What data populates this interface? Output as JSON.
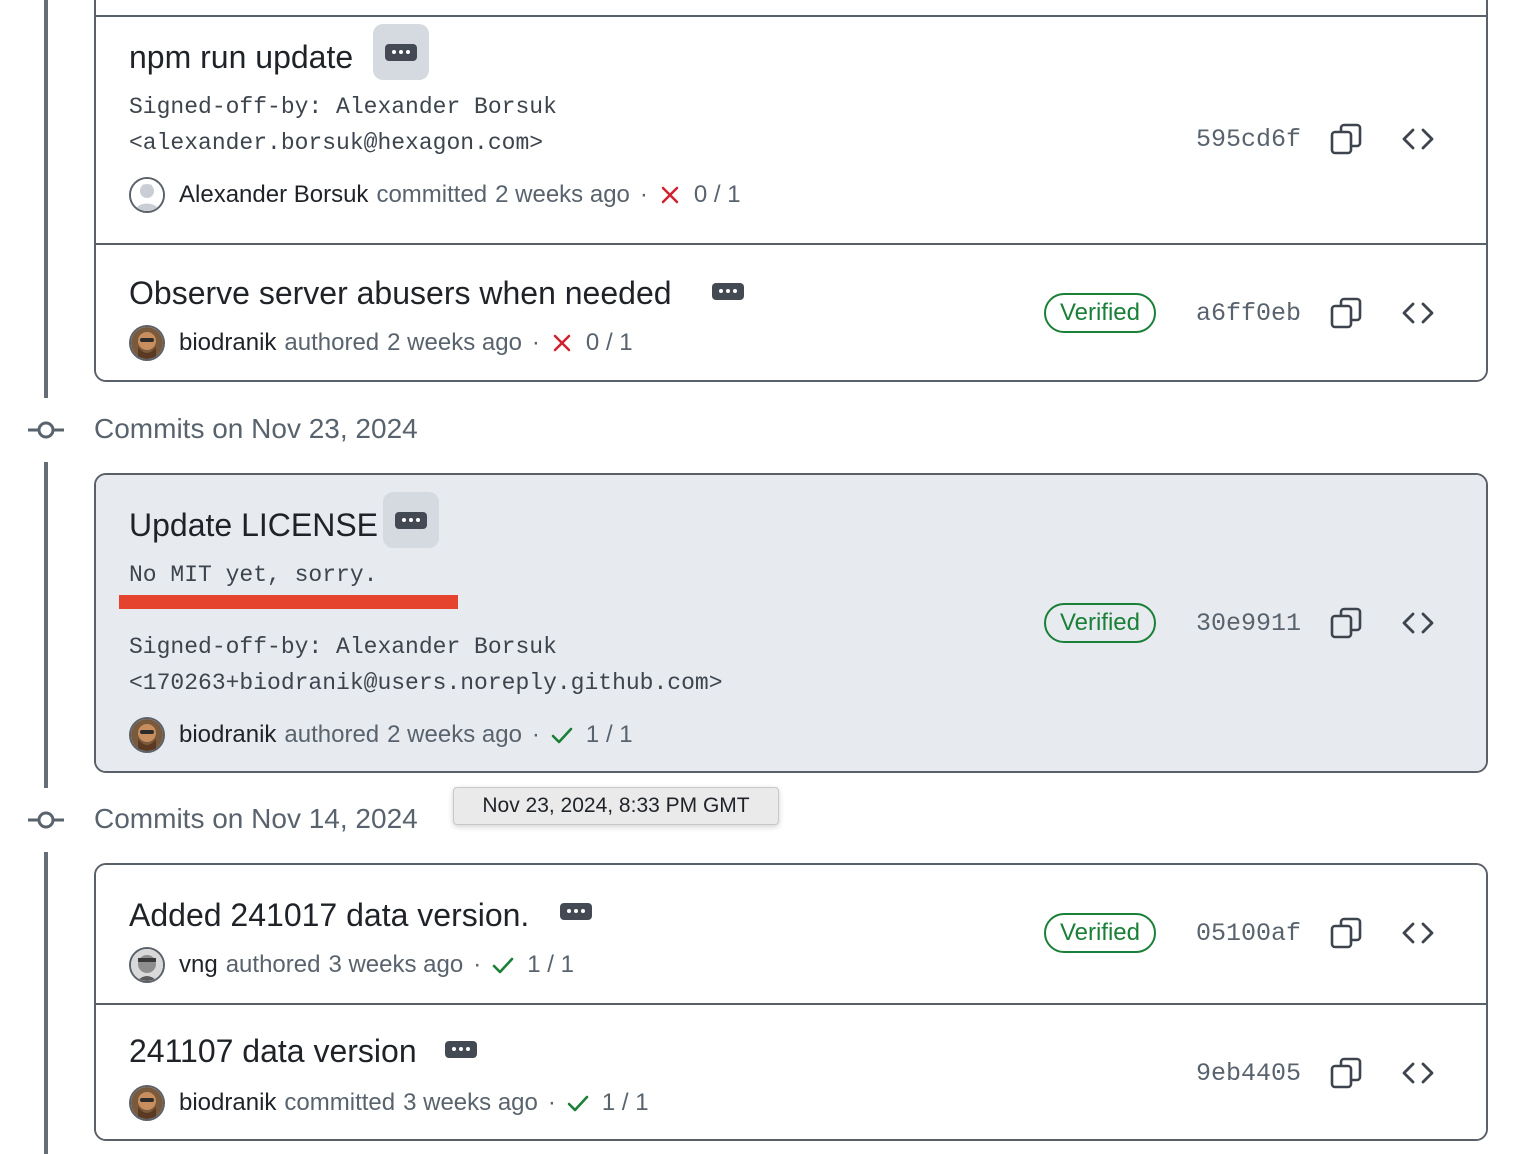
{
  "groups": [
    {
      "commits": [
        {
          "title": "npm run update",
          "body": "Signed-off-by: Alexander Borsuk\n<alexander.borsuk@hexagon.com>",
          "author": "Alexander Borsuk",
          "action": "committed",
          "time": "2 weeks ago",
          "checks_status": "failure",
          "checks": "0 / 1",
          "verified": null,
          "sha": "595cd6f",
          "avatar_icon": "github-default-avatar-icon"
        },
        {
          "title": "Observe server abusers when needed",
          "author": "biodranik",
          "action": "authored",
          "time": "2 weeks ago",
          "checks_status": "failure",
          "checks": "0 / 1",
          "verified": "Verified",
          "sha": "a6ff0eb",
          "avatar_icon": "user-avatar-icon"
        }
      ]
    },
    {
      "date_heading": "Commits on Nov 23, 2024",
      "commits": [
        {
          "title": "Update LICENSE",
          "body_line1": "No MIT yet, sorry.",
          "body_signoff": "Signed-off-by: Alexander Borsuk\n<170263+biodranik@users.noreply.github.com>",
          "author": "biodranik",
          "action": "authored",
          "time": "2 weeks ago",
          "checks_status": "success",
          "checks": "1 / 1",
          "verified": "Verified",
          "sha": "30e9911",
          "avatar_icon": "user-avatar-icon"
        }
      ]
    },
    {
      "date_heading": "Commits on Nov 14, 2024",
      "commits": [
        {
          "title": "Added 241017 data version.",
          "author": "vng",
          "action": "authored",
          "time": "3 weeks ago",
          "checks_status": "success",
          "checks": "1 / 1",
          "verified": "Verified",
          "sha": "05100af",
          "avatar_icon": "user-avatar-icon"
        },
        {
          "title": "241107 data version",
          "author": "biodranik",
          "action": "committed",
          "time": "3 weeks ago",
          "checks_status": "success",
          "checks": "1 / 1",
          "verified": null,
          "sha": "9eb4405",
          "avatar_icon": "user-avatar-icon"
        }
      ]
    }
  ],
  "tooltip": "Nov 23, 2024, 8:33 PM GMT",
  "colors": {
    "verified": "#1a7f37",
    "failure": "#cf222e",
    "success": "#1a7f37",
    "highlight_row": "#e7ebf0",
    "annotation_underline": "#e5432d"
  }
}
